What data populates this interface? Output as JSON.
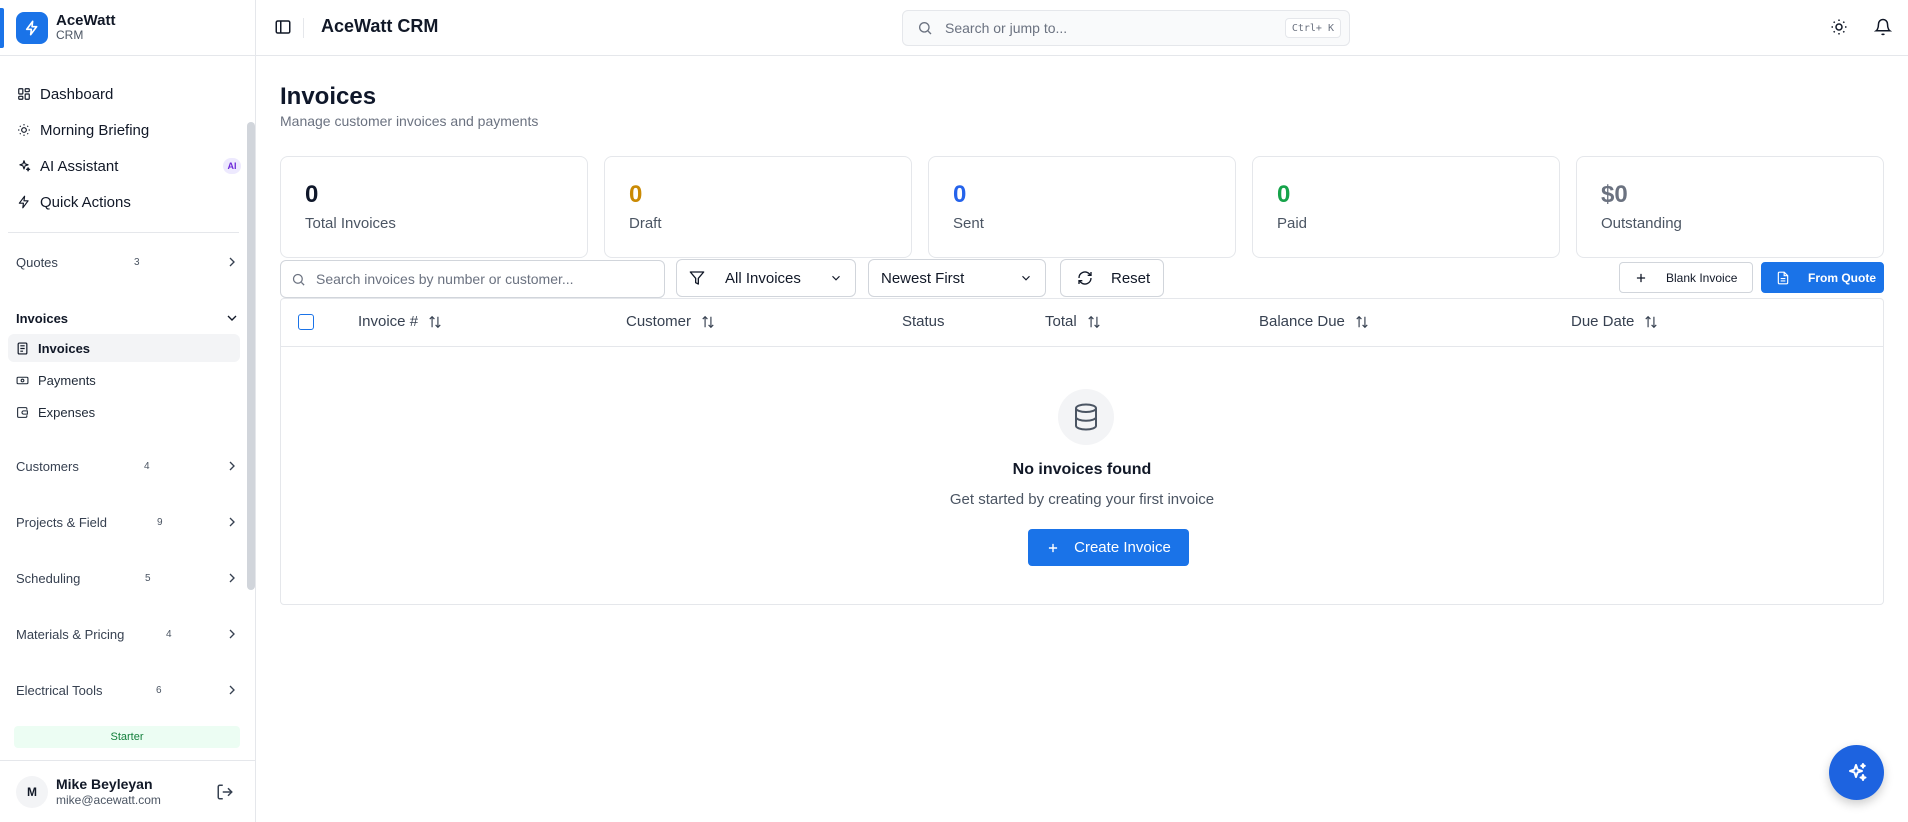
{
  "brand": {
    "name": "AceWatt",
    "sub": "CRM"
  },
  "header": {
    "title": "AceWatt CRM",
    "search_placeholder": "Search or jump to...",
    "shortcut": "Ctrl+ K"
  },
  "sidebar": {
    "top_items": [
      {
        "label": "Dashboard",
        "icon": "dashboard-icon"
      },
      {
        "label": "Morning Briefing",
        "icon": "sun-icon"
      },
      {
        "label": "AI Assistant",
        "icon": "sparkles-icon",
        "badge": "AI"
      },
      {
        "label": "Quick Actions",
        "icon": "bolt-icon"
      }
    ],
    "groups": {
      "quotes": {
        "label": "Quotes",
        "count": "3"
      },
      "invoices": {
        "label": "Invoices"
      },
      "customers": {
        "label": "Customers",
        "count": "4"
      },
      "projects": {
        "label": "Projects & Field",
        "count": "9"
      },
      "scheduling": {
        "label": "Scheduling",
        "count": "5"
      },
      "materials": {
        "label": "Materials & Pricing",
        "count": "4"
      },
      "electrical": {
        "label": "Electrical Tools",
        "count": "6"
      }
    },
    "invoice_items": [
      {
        "label": "Invoices",
        "icon": "receipt-icon",
        "active": true
      },
      {
        "label": "Payments",
        "icon": "banknote-icon"
      },
      {
        "label": "Expenses",
        "icon": "wallet-icon"
      }
    ],
    "plan": "Starter",
    "user": {
      "initial": "M",
      "name": "Mike Beyleyan",
      "email": "mike@acewatt.com"
    }
  },
  "page": {
    "title": "Invoices",
    "subtitle": "Manage customer invoices and payments"
  },
  "stats": [
    {
      "value": "0",
      "label": "Total Invoices",
      "color": "#0f172a"
    },
    {
      "value": "0",
      "label": "Draft",
      "color": "#ca8a04"
    },
    {
      "value": "0",
      "label": "Sent",
      "color": "#2563eb"
    },
    {
      "value": "0",
      "label": "Paid",
      "color": "#16a34a"
    },
    {
      "value": "$0",
      "label": "Outstanding",
      "color": "#6b7280"
    }
  ],
  "toolbar": {
    "search_placeholder": "Search invoices by number or customer...",
    "filter_value": "All Invoices",
    "sort_value": "Newest First",
    "reset_label": "Reset",
    "blank_invoice_label": "Blank Invoice",
    "from_quote_label": "From Quote"
  },
  "table": {
    "columns": [
      "Invoice #",
      "Customer",
      "Status",
      "Total",
      "Balance Due",
      "Due Date"
    ],
    "empty_title": "No invoices found",
    "empty_subtitle": "Get started by creating your first invoice",
    "create_label": "Create Invoice"
  },
  "colors": {
    "accent": "#1a73e8"
  }
}
